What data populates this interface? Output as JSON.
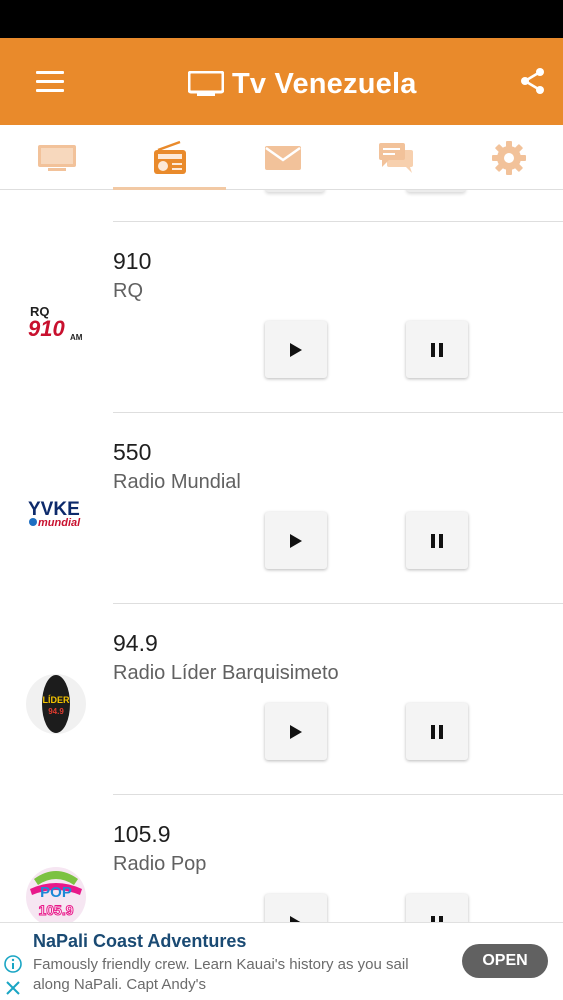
{
  "app": {
    "title": "Tv Venezuela"
  },
  "colors": {
    "primary": "#e98a2b",
    "tab_icon": "#f2c29a",
    "tab_icon_active": "#e98a2b",
    "ad_title": "#1a4a73",
    "ad_button": "#616161"
  },
  "icons": {
    "menu": "hamburger-icon",
    "title": "tv-icon",
    "share": "share-icon"
  },
  "tabs": [
    {
      "icon": "tv-icon",
      "active": false
    },
    {
      "icon": "radio-icon",
      "active": true
    },
    {
      "icon": "mail-icon",
      "active": false
    },
    {
      "icon": "chat-icon",
      "active": false
    },
    {
      "icon": "gear-icon",
      "active": false
    }
  ],
  "stations": [
    {
      "frequency": "910",
      "name": "RQ",
      "logo_text": "RQ 910 AM",
      "play_icon": "play-icon",
      "pause_icon": "pause-icon"
    },
    {
      "frequency": "550",
      "name": "Radio Mundial",
      "logo_text": "YVKE mundial",
      "play_icon": "play-icon",
      "pause_icon": "pause-icon"
    },
    {
      "frequency": "94.9",
      "name": "Radio Líder Barquisimeto",
      "logo_text": "LÍDER 94.9",
      "play_icon": "play-icon",
      "pause_icon": "pause-icon"
    },
    {
      "frequency": "105.9",
      "name": "Radio Pop",
      "logo_text": "POP FM 105.9",
      "play_icon": "play-icon",
      "pause_icon": "pause-icon"
    }
  ],
  "ad": {
    "title": "NaPali Coast Adventures",
    "body": "Famously friendly crew. Learn Kauai's history as you sail along NaPali. Capt Andy's",
    "button": "OPEN"
  }
}
